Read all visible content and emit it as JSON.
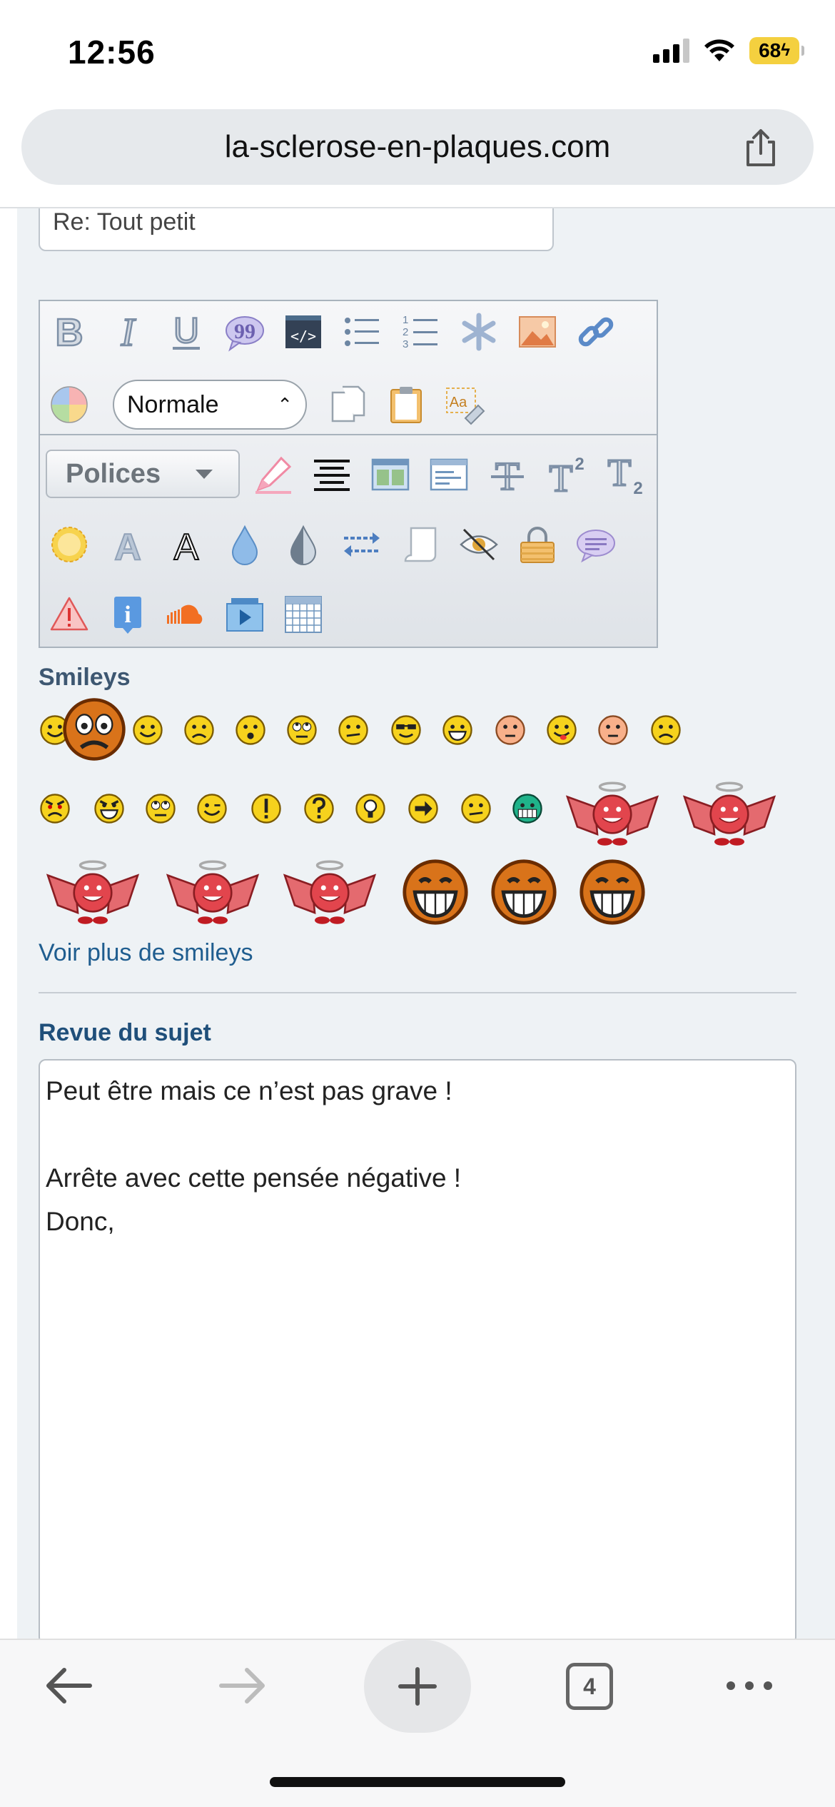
{
  "status": {
    "time": "12:56",
    "battery": "68"
  },
  "browser": {
    "url": "la-sclerose-en-plaques.com",
    "tabs_count": "4"
  },
  "form": {
    "subject_value": "Re: Tout petit",
    "format_select": "Normale",
    "fonts_button": "Polices"
  },
  "toolbar_icons": [
    "bold-icon",
    "italic-icon",
    "underline-icon",
    "quote-icon",
    "code-icon",
    "bullet-list-icon",
    "numbered-list-icon",
    "asterisk-icon",
    "image-icon",
    "link-icon",
    "color-wheel-icon",
    "copy-icon",
    "paste-icon",
    "remove-format-icon",
    "highlighter-icon",
    "align-icon",
    "table-layout-icon",
    "window-icon",
    "strikethrough-icon",
    "superscript-icon",
    "subscript-icon",
    "sun-icon",
    "outline-letter-icon",
    "letter-a-icon",
    "drop-icon",
    "half-drop-icon",
    "arrows-swap-icon",
    "scroll-icon",
    "hidden-eye-icon",
    "padlock-icon",
    "speech-bubble-icon",
    "warning-icon",
    "info-icon",
    "soundcloud-icon",
    "video-icon",
    "grid-table-icon"
  ],
  "smileys": {
    "title": "Smileys",
    "more_link": "Voir plus de smileys"
  },
  "review": {
    "title": "Revue du sujet",
    "lines": [
      "Peut être mais ce n’est pas grave !",
      "",
      "Arrête avec cette pensée négative !",
      "Donc,"
    ]
  },
  "colors": {
    "link": "#1f5d8f",
    "heading": "#3d5771",
    "page_bg": "#eef2f5",
    "battery": "#f4d03f"
  }
}
